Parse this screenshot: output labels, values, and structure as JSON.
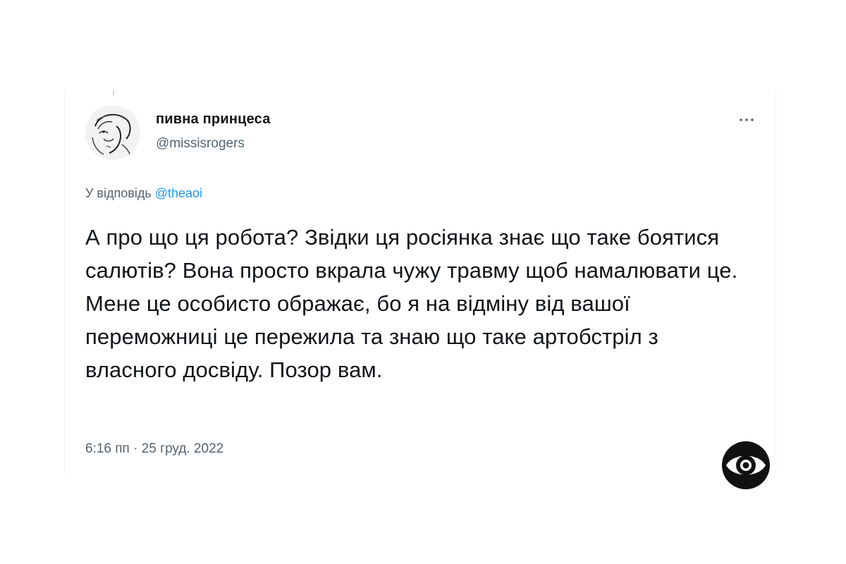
{
  "tweet": {
    "author": {
      "display_name": "пивна принцеса",
      "handle": "@missisrogers",
      "avatar_icon": "avatar-sketch"
    },
    "more_icon": "more-dots-icon",
    "reply": {
      "prefix": "У відповідь ",
      "mention": "@theaoi"
    },
    "text": "А про що ця робота? Звідки ця росіянка знає що таке боятися салютів? Вона просто вкрала чужу травму щоб намалювати це. Мене це особисто ображає, бо я на відміну від вашої переможниці це пережила та знаю що таке артобстріл з власного досвіду. Позор вам.",
    "timestamp": "6:16 пп · 25 груд. 2022"
  },
  "watermark_icon": "eye-logo-icon",
  "colors": {
    "text_primary": "#0f1419",
    "text_secondary": "#536471",
    "link": "#1d9bf0",
    "border": "#eff3f4"
  }
}
